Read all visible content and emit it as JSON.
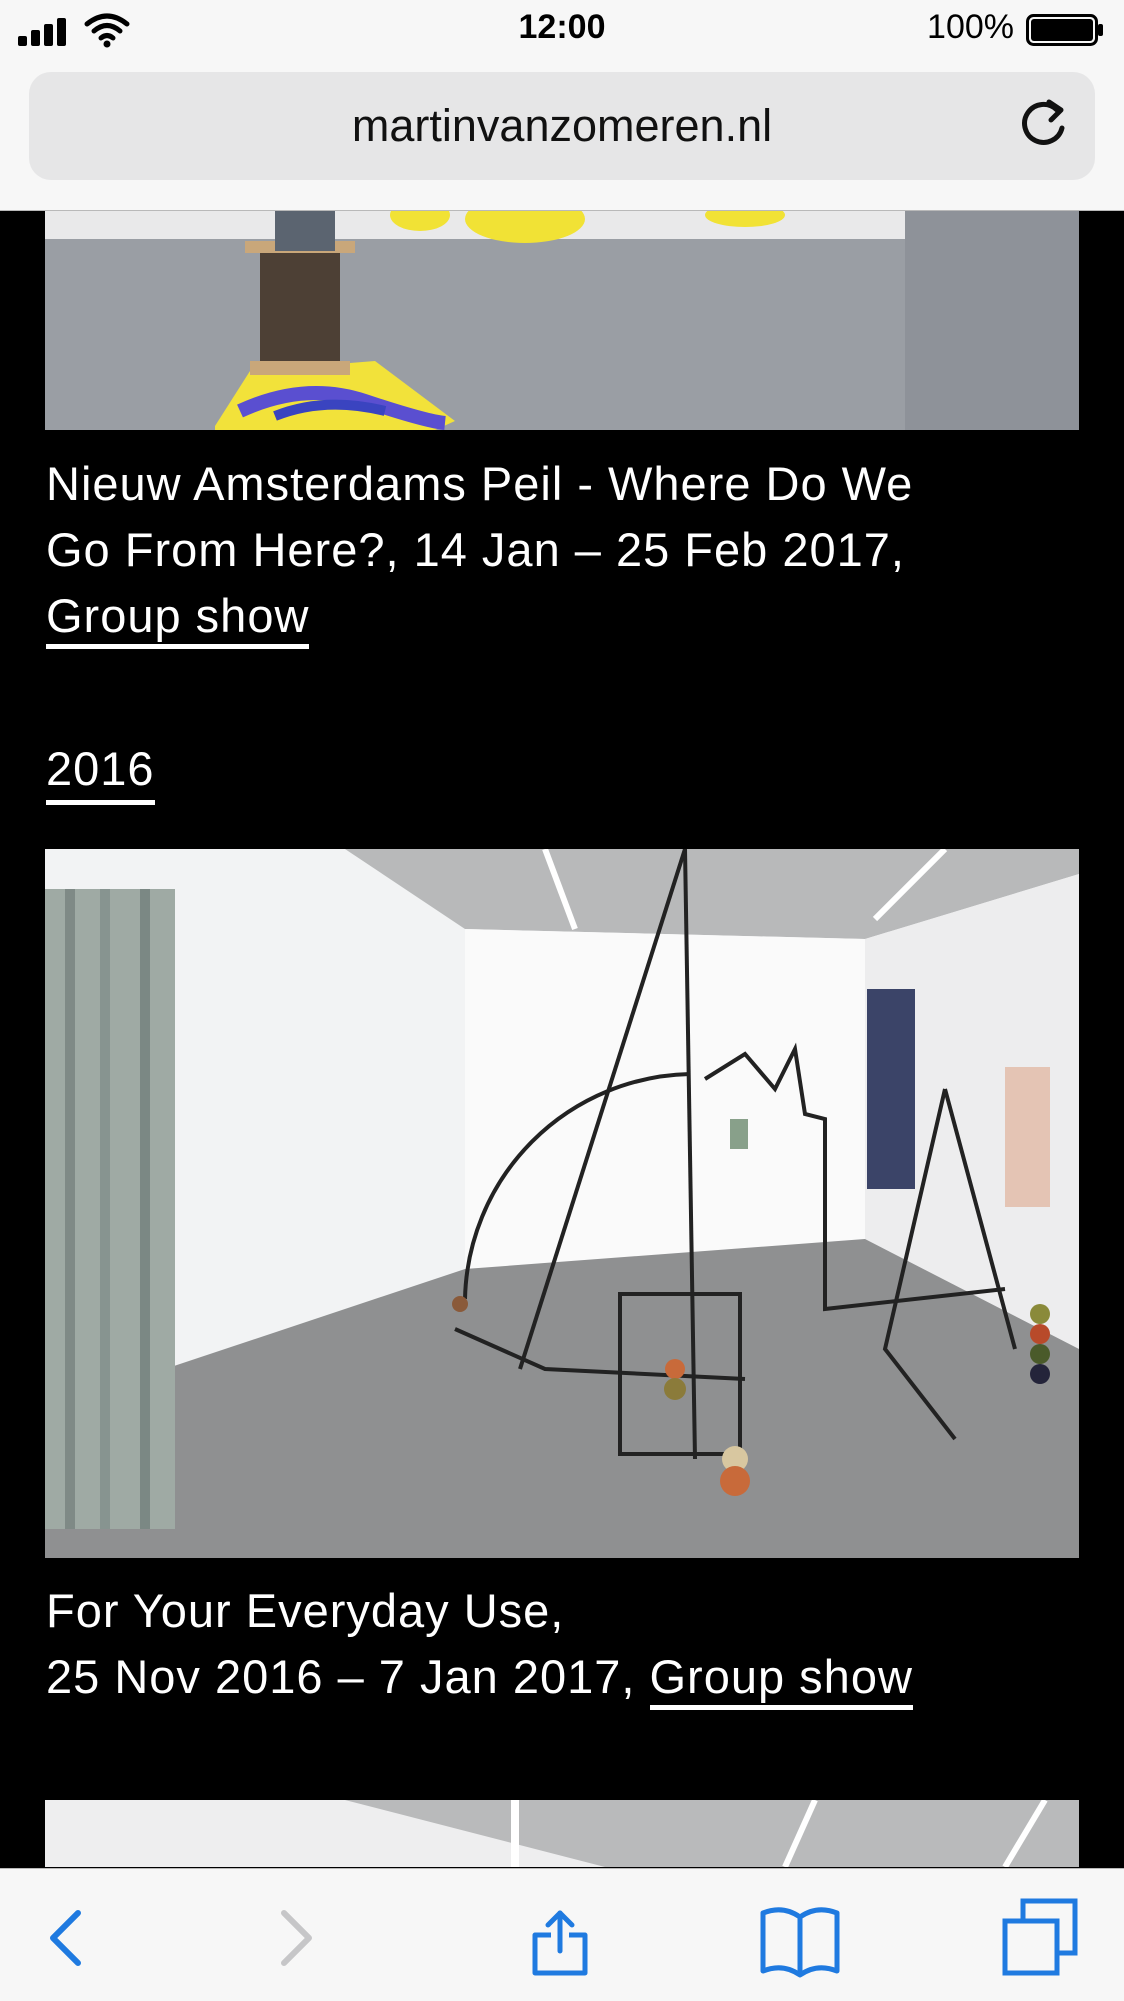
{
  "status_bar": {
    "time": "12:00",
    "battery": "100%"
  },
  "browser": {
    "url": "martinvanzomeren.nl"
  },
  "colors": {
    "accent": "#1f7ae0",
    "disabled": "#c6c6c8",
    "page_bg": "#000000",
    "text": "#ffffff"
  },
  "exhibitions": [
    {
      "title": "Nieuw Amsterdams Peil - Where Do We",
      "title_line2": "Go From Here?, 14 Jan – 25 Feb 2017,",
      "link": "Group show"
    },
    {
      "title": "For Your Everyday Use,",
      "dates": "25 Nov 2016 – 7 Jan 2017,",
      "link": "Group show"
    }
  ],
  "year_heading": "2016",
  "toolbar_icons": [
    "back-icon",
    "forward-icon",
    "share-icon",
    "bookmarks-icon",
    "tabs-icon"
  ]
}
